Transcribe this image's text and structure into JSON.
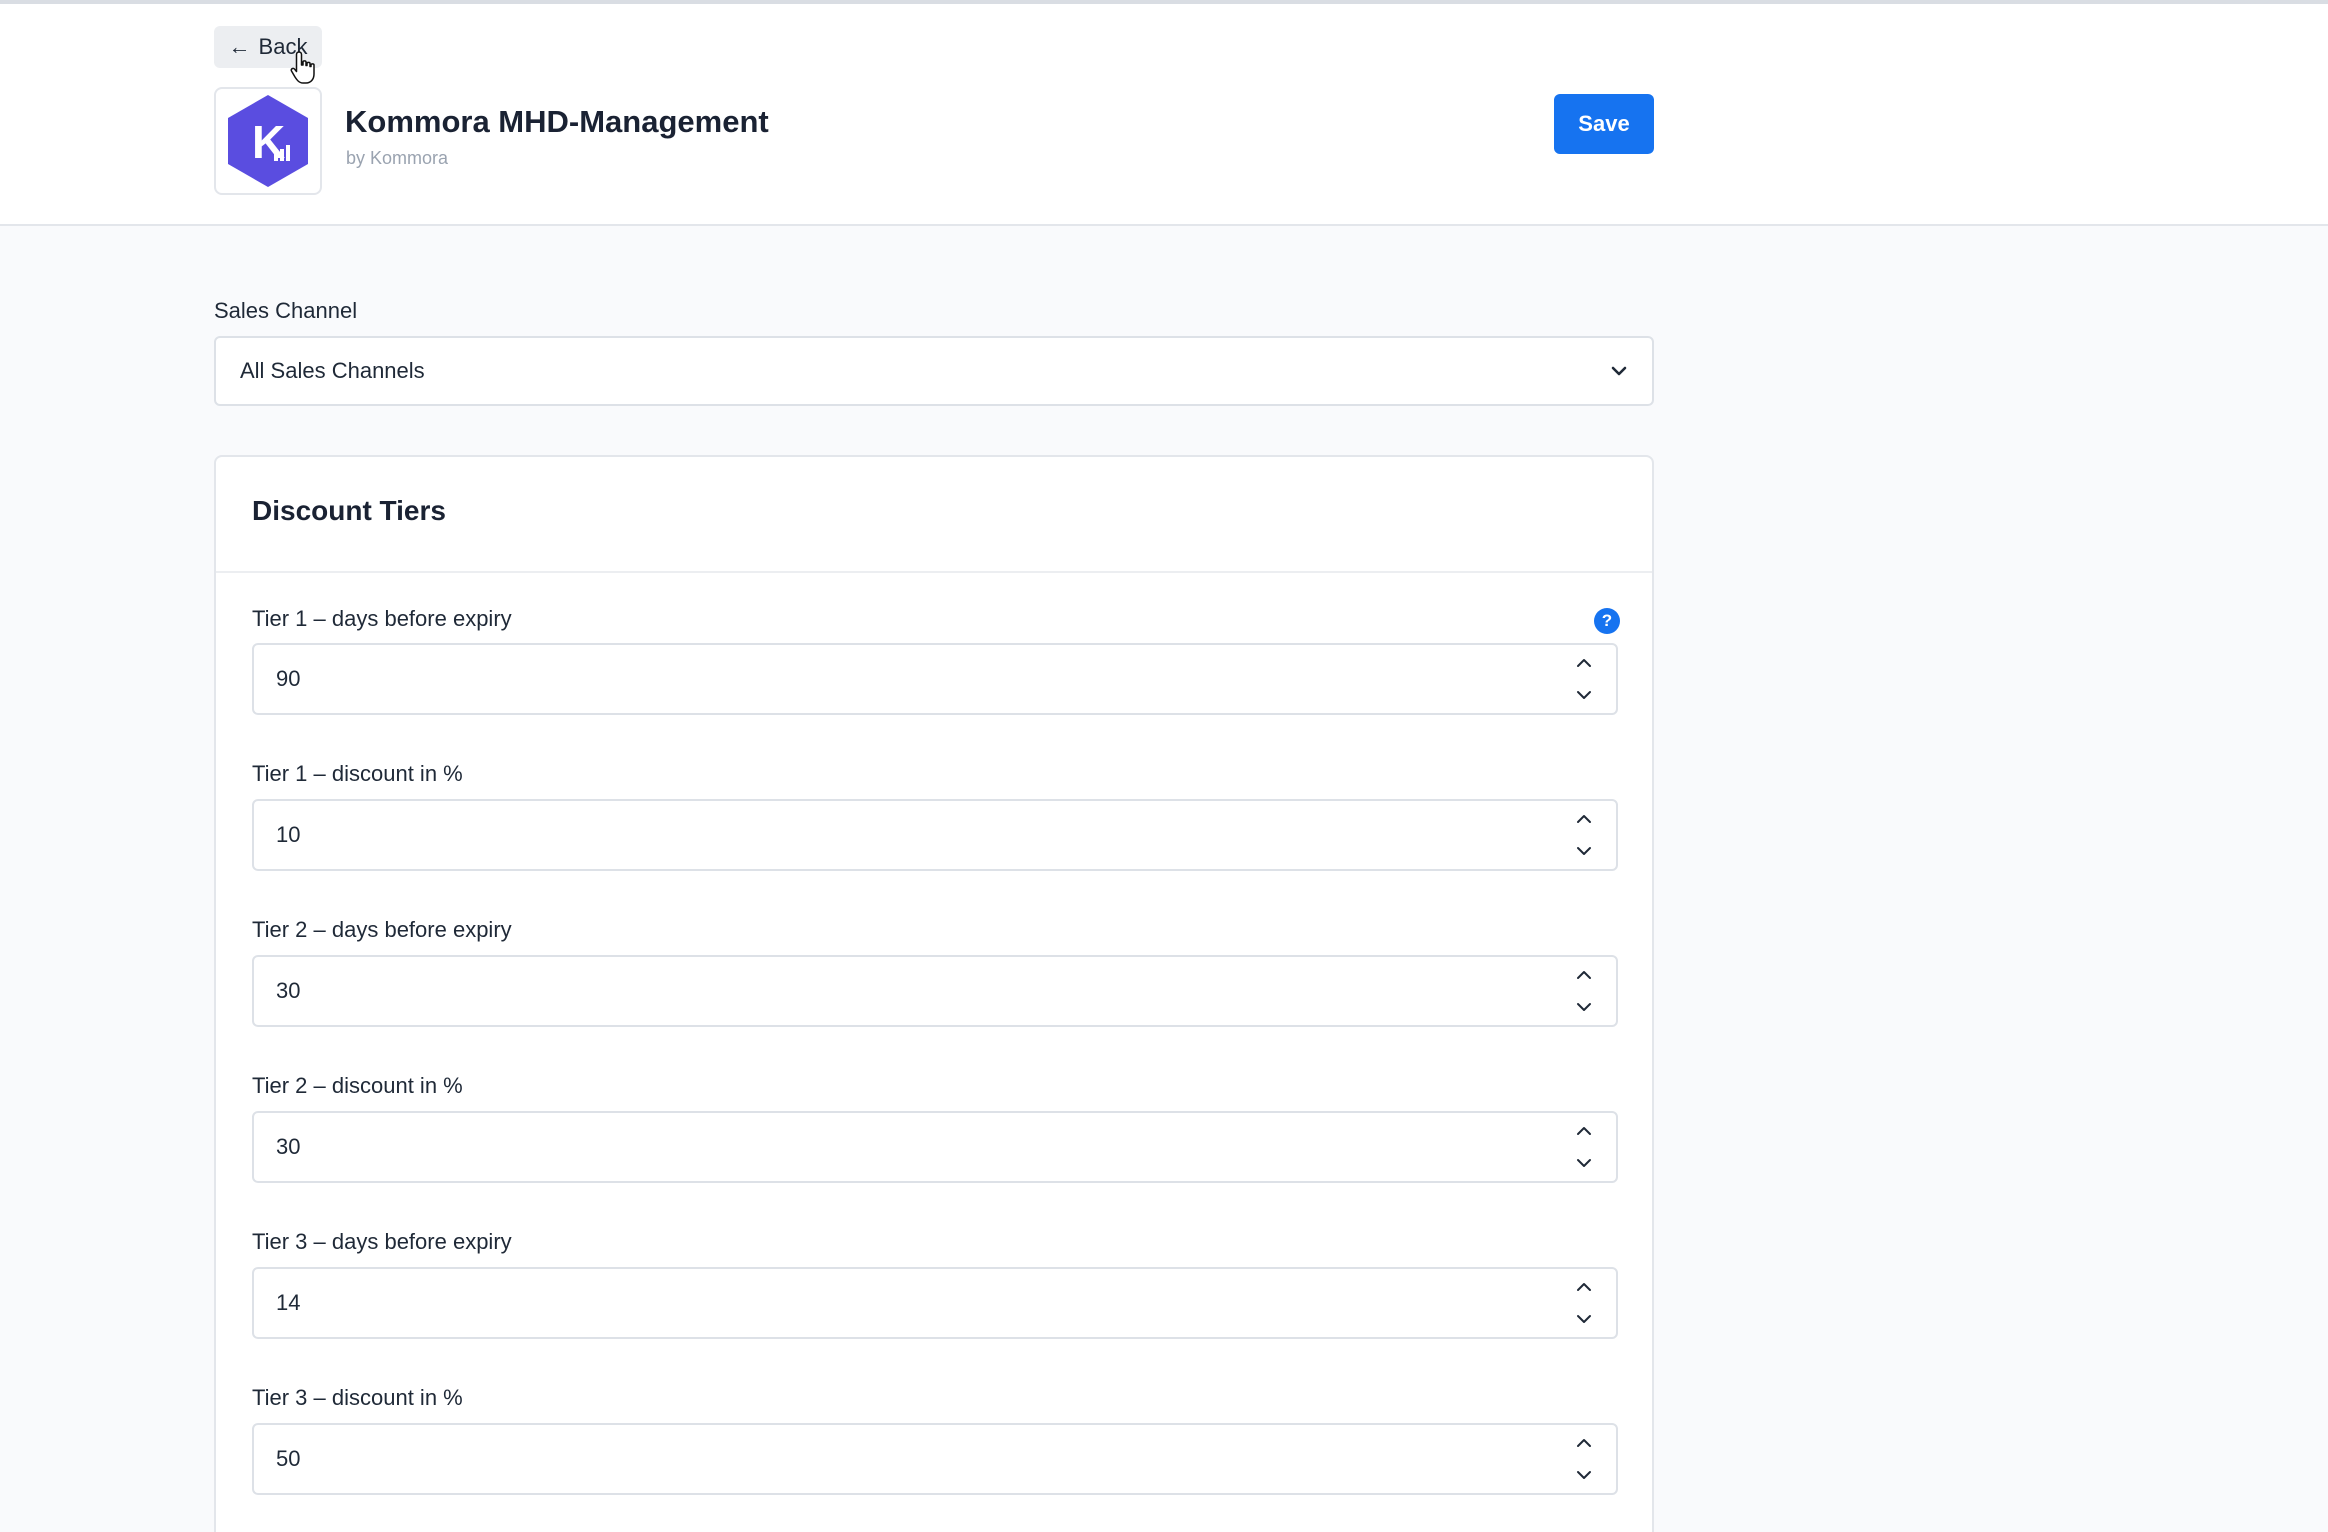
{
  "header": {
    "back_label": "Back",
    "app_title": "Kommora MHD-Management",
    "app_vendor": "by Kommora",
    "save_label": "Save",
    "logo_letter": "K"
  },
  "sales_channel": {
    "label": "Sales Channel",
    "selected": "All Sales Channels"
  },
  "discount_tiers": {
    "title": "Discount Tiers",
    "help_symbol": "?",
    "fields": [
      {
        "label": "Tier 1 – days before expiry",
        "value": "90"
      },
      {
        "label": "Tier 1 – discount in %",
        "value": "10"
      },
      {
        "label": "Tier 2 – days before expiry",
        "value": "30"
      },
      {
        "label": "Tier 2 – discount in %",
        "value": "30"
      },
      {
        "label": "Tier 3 – days before expiry",
        "value": "14"
      },
      {
        "label": "Tier 3 – discount in %",
        "value": "50"
      }
    ]
  },
  "icons": {
    "back": "arrow-left-icon",
    "dropdown": "chevron-down-icon",
    "help": "question-mark-icon",
    "stepper_up": "chevron-up-icon",
    "stepper_down": "chevron-down-icon",
    "cursor": "hand-pointer-icon"
  },
  "colors": {
    "accent": "#1673f0",
    "logo": "#5a4de0",
    "page_bg": "#f9fafc"
  }
}
